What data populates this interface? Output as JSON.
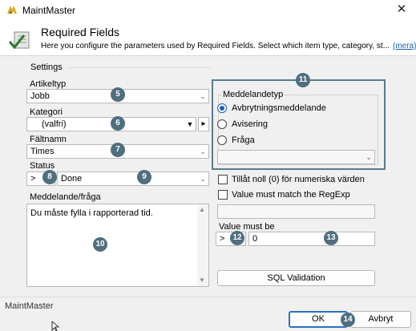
{
  "window": {
    "title": "MaintMaster",
    "close_glyph": "✕"
  },
  "header": {
    "title": "Required Fields",
    "description": "Here you configure the parameters used by Required Fields. Select which item type, category, st...",
    "more_link": "(mera)"
  },
  "settings": {
    "group_label": "Settings",
    "item_type": {
      "label": "Artikeltyp",
      "value": "Jobb"
    },
    "category": {
      "label": "Kategori",
      "value": "(valfri)",
      "nav_glyph": "▸"
    },
    "field_name": {
      "label": "Fältnamn",
      "value": "Times"
    },
    "status": {
      "label": "Status",
      "operator": ">",
      "value": "Done"
    },
    "message": {
      "label": "Meddelande/fråga",
      "value": "Du måste fylla i rapporterad tid."
    }
  },
  "message_type": {
    "label": "Meddelandetyp",
    "options": [
      "Avbrytningsmeddelande",
      "Avisering",
      "Fråga"
    ],
    "selected": "Avbrytningsmeddelande",
    "dropdown_value": ""
  },
  "options": {
    "allow_zero": {
      "label": "Tillåt noll (0) för numeriska värden",
      "checked": false
    },
    "regexp": {
      "label": "Value must match the RegExp",
      "checked": false
    },
    "regexp_value": ""
  },
  "value_must_be": {
    "label": "Value must be",
    "operator": ">",
    "value": "0"
  },
  "sql_button": "SQL Validation",
  "footer": {
    "text": "MaintMaster",
    "ok": "OK",
    "cancel": "Avbryt"
  },
  "badges": [
    "5",
    "6",
    "7",
    "8",
    "9",
    "10",
    "11",
    "12",
    "13",
    "14"
  ],
  "icons": [
    "maintmaster-logo-icon",
    "close-icon",
    "checklist-icon",
    "dropdown-arrow-icon",
    "radio-icon",
    "checkbox-icon",
    "mouse-cursor-icon"
  ],
  "colors": {
    "badge": "#4f6f7f",
    "highlight_frame": "#5a7b8c",
    "primary": "#2b6fc6",
    "link": "#1a5fb4"
  }
}
